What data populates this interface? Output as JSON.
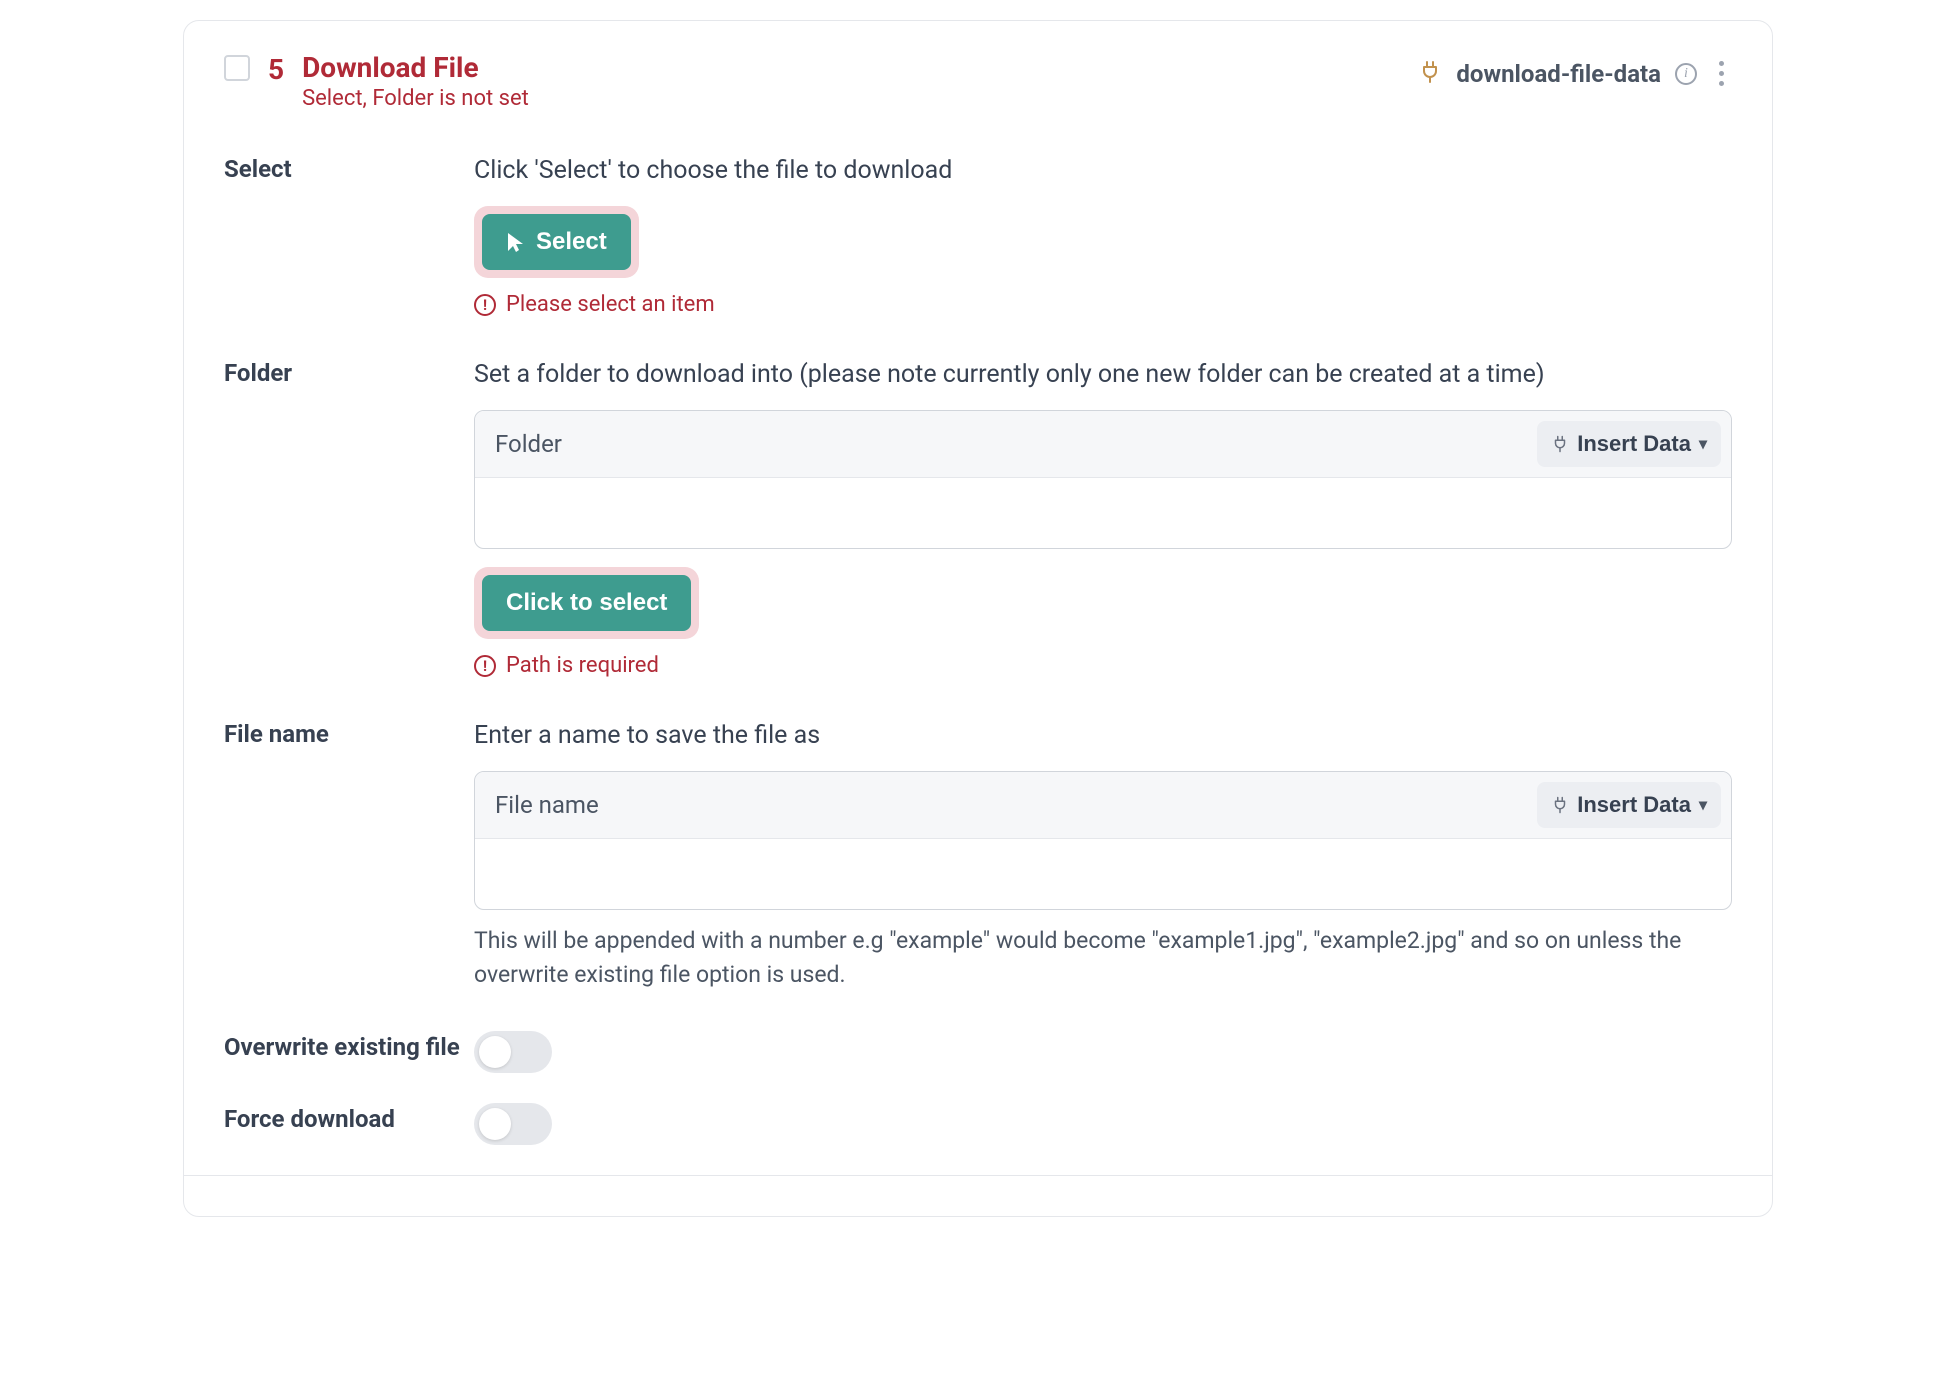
{
  "header": {
    "step_number": "5",
    "title": "Download File",
    "subtitle": "Select, Folder is not set",
    "module_name": "download-file-data"
  },
  "fields": {
    "select": {
      "label": "Select",
      "help": "Click 'Select' to choose the file to download",
      "button": "Select",
      "error": "Please select an item"
    },
    "folder": {
      "label": "Folder",
      "help": "Set a folder to download into (please note currently only one new folder can be created at a time)",
      "input_label": "Folder",
      "insert_data": "Insert Data",
      "button": "Click to select",
      "error": "Path is required"
    },
    "filename": {
      "label": "File name",
      "help": "Enter a name to save the file as",
      "input_label": "File name",
      "insert_data": "Insert Data",
      "hint": "This will be appended with a number e.g \"example\" would become \"example1.jpg\", \"example2.jpg\" and so on unless the overwrite existing file option is used."
    },
    "overwrite": {
      "label": "Overwrite existing file",
      "value": false
    },
    "force": {
      "label": "Force download",
      "value": false
    }
  }
}
